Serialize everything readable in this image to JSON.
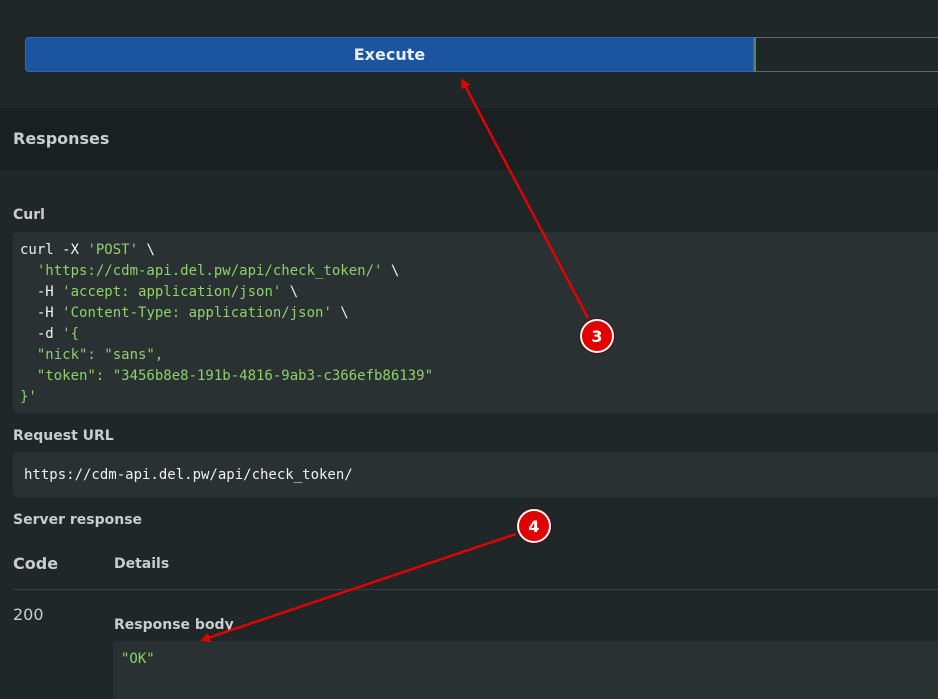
{
  "execute": {
    "label": "Execute"
  },
  "responses": {
    "title": "Responses"
  },
  "curl": {
    "label": "Curl",
    "lines": [
      [
        {
          "t": "curl -X ",
          "c": "p"
        },
        {
          "t": "'POST'",
          "c": "s"
        },
        {
          "t": " \\",
          "c": "p"
        }
      ],
      [
        {
          "t": "  ",
          "c": "p"
        },
        {
          "t": "'https://cdm-api.del.pw/api/check_token/'",
          "c": "s"
        },
        {
          "t": " \\",
          "c": "p"
        }
      ],
      [
        {
          "t": "  -H ",
          "c": "p"
        },
        {
          "t": "'accept: application/json'",
          "c": "s"
        },
        {
          "t": " \\",
          "c": "p"
        }
      ],
      [
        {
          "t": "  -H ",
          "c": "p"
        },
        {
          "t": "'Content-Type: application/json'",
          "c": "s"
        },
        {
          "t": " \\",
          "c": "p"
        }
      ],
      [
        {
          "t": "  -d ",
          "c": "p"
        },
        {
          "t": "'{",
          "c": "s"
        }
      ],
      [
        {
          "t": "  \"nick\": \"sans\",",
          "c": "s"
        }
      ],
      [
        {
          "t": "  \"token\": \"3456b8e8-191b-4816-9ab3-c366efb86139\"",
          "c": "s"
        }
      ],
      [
        {
          "t": "}'",
          "c": "s"
        }
      ]
    ]
  },
  "request_url": {
    "label": "Request URL",
    "value": "https://cdm-api.del.pw/api/check_token/"
  },
  "server_response": {
    "label": "Server response",
    "code_header": "Code",
    "details_header": "Details",
    "code": "200",
    "body_label": "Response body",
    "body": "\"OK\""
  },
  "annotations": {
    "badge_3": "3",
    "badge_4": "4",
    "color": "#e00000"
  }
}
